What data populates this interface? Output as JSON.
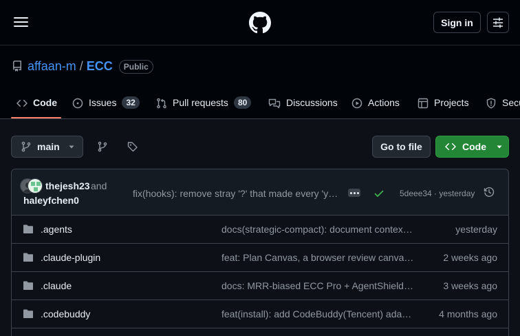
{
  "header": {
    "sign_in_label": "Sign in"
  },
  "repo": {
    "owner": "affaan-m",
    "separator": "/",
    "name": "ECC",
    "visibility": "Public"
  },
  "tabs": [
    {
      "label": "Code",
      "icon": "code-icon",
      "active": true
    },
    {
      "label": "Issues",
      "icon": "issue-opened-icon",
      "count": "32"
    },
    {
      "label": "Pull requests",
      "icon": "git-pull-request-icon",
      "count": "80"
    },
    {
      "label": "Discussions",
      "icon": "comment-discussion-icon"
    },
    {
      "label": "Actions",
      "icon": "play-icon"
    },
    {
      "label": "Projects",
      "icon": "table-icon"
    },
    {
      "label": "Security",
      "icon": "shield-icon"
    }
  ],
  "toolbar": {
    "branch": "main",
    "goto_file_label": "Go to file",
    "code_label": "Code"
  },
  "last_commit": {
    "author1": "thejesh23",
    "and_text": "and",
    "author2": "haleyfchen0",
    "message": "fix(hooks): remove stray '?' that made every 'yaml' rule...",
    "hash_and_time": "5deee34 · yesterday"
  },
  "files": [
    {
      "name": ".agents",
      "message": "docs(strategic-compact): document context-mode integration",
      "date": "yesterday"
    },
    {
      "name": ".claude-plugin",
      "message": "feat: Plan Canvas, a browser review canvas for plans",
      "date": "2 weeks ago"
    },
    {
      "name": ".claude",
      "message": "docs: MRR-biased ECC Pro + AgentShield setup notes",
      "date": "3 weeks ago"
    },
    {
      "name": ".codebuddy",
      "message": "feat(install): add CodeBuddy(Tencent) adapter support",
      "date": "4 months ago"
    }
  ],
  "colors": {
    "accent_link": "#4493f8",
    "tab_underline": "#f78166",
    "code_button": "#238636",
    "success": "#3fb950"
  }
}
